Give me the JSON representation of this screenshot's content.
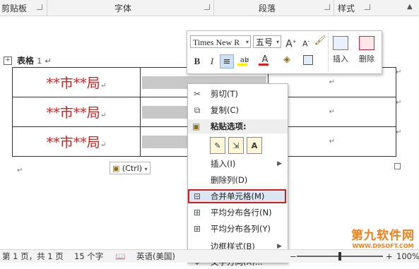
{
  "ribbon": {
    "groups": [
      "剪贴板",
      "字体",
      "段落",
      "样式"
    ]
  },
  "document": {
    "caption_label": "表格",
    "caption_num": "1",
    "rows": [
      {
        "name": "**市**局"
      },
      {
        "name": "**市**局"
      },
      {
        "name": "**市**局"
      }
    ],
    "mark": "↵"
  },
  "mini_toolbar": {
    "font_name": "Times New R",
    "font_size": "五号",
    "grow_font": "A",
    "shrink_font": "A",
    "bold": "B",
    "italic": "I",
    "insert_label": "插入",
    "delete_label": "删除"
  },
  "context_menu": {
    "items": [
      {
        "label": "剪切(T)",
        "icon": "scissors-icon"
      },
      {
        "label": "复制(C)",
        "icon": "copy-icon"
      },
      {
        "label": "粘贴选项:",
        "icon": "paste-icon"
      },
      {
        "label": "插入(I)",
        "submenu": true
      },
      {
        "label": "删除列(D)"
      },
      {
        "label": "合并单元格(M)",
        "icon": "merge-cells-icon",
        "highlighted": true
      },
      {
        "label": "平均分布各行(N)",
        "icon": "distribute-rows-icon"
      },
      {
        "label": "平均分布各列(Y)",
        "icon": "distribute-columns-icon"
      },
      {
        "label": "边框样式(B)",
        "submenu": true
      },
      {
        "label": "文字方向(X)...",
        "icon": "text-direction-icon"
      }
    ],
    "paste_options": [
      "A"
    ],
    "highlight_color": "#d01e1e"
  },
  "paste_tag": {
    "label": "(Ctrl)"
  },
  "status_bar": {
    "page": "第 1 页，共 1 页",
    "words": "15 个字",
    "language": "英语(美国)",
    "zoom": "100%",
    "zoom_level": 0.5
  },
  "watermark": {
    "line1": "第九软件网",
    "line2": "WWW.D9SOFT.COM"
  }
}
